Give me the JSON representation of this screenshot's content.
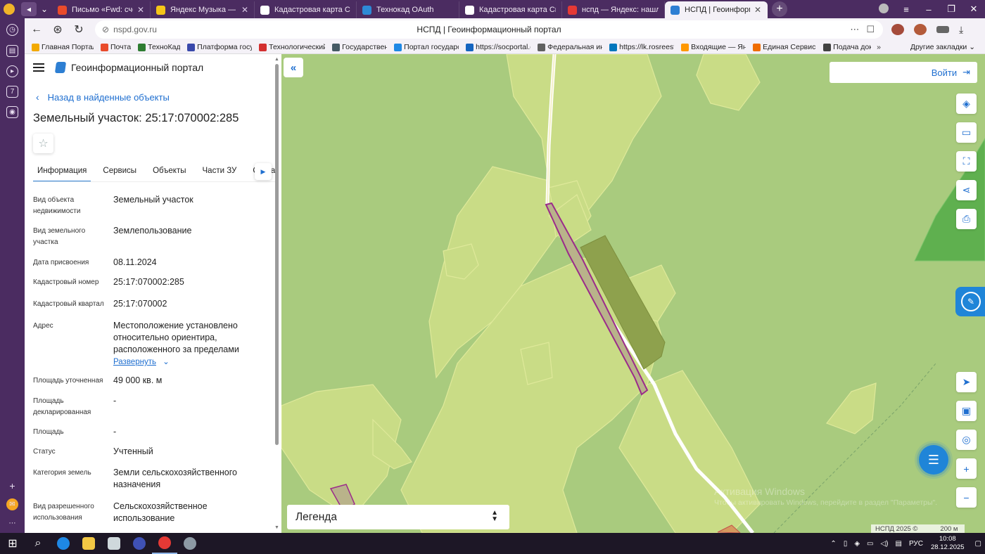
{
  "browser": {
    "tabs": [
      {
        "label": "Письмо «Fwd: счет за декабрь»",
        "icon": "mail-icon",
        "color": "#e94b2b",
        "active": false
      },
      {
        "label": "Яндекс Музыка — со",
        "icon": "music-icon",
        "color": "#f5c518",
        "active": false
      },
      {
        "label": "Кадастровая карта Сибири",
        "icon": "document-icon",
        "color": "#ffffff",
        "active": false
      },
      {
        "label": "Технокад OAuth",
        "icon": "technokad-icon",
        "color": "#2d8ad6",
        "active": false
      },
      {
        "label": "Кадастровая карта Сибири",
        "icon": "document-icon",
        "color": "#ffffff",
        "active": false
      },
      {
        "label": "нспд — Яндекс: нашлось",
        "icon": "yandex-icon",
        "color": "#e53935",
        "active": false
      },
      {
        "label": "НСПД | Геоинформационный",
        "icon": "nspd-icon",
        "color": "#2d7fd3",
        "active": true
      }
    ],
    "url": "nspd.gov.ru",
    "page_title": "НСПД | Геоинформационный портал",
    "bookmarks": [
      {
        "label": "Главная Портал Э",
        "color": "#f2a900"
      },
      {
        "label": "Почта",
        "color": "#e94b2b"
      },
      {
        "label": "ТехноКад",
        "color": "#2e7d32"
      },
      {
        "label": "Платформа госуд",
        "color": "#3949ab"
      },
      {
        "label": "Технологический",
        "color": "#d32f2f"
      },
      {
        "label": "Государственная",
        "color": "#455a64"
      },
      {
        "label": "Портал государст",
        "color": "#1e88e5"
      },
      {
        "label": "https://socportal.g",
        "color": "#1565c0"
      },
      {
        "label": "Федеральная инф",
        "color": "#616161"
      },
      {
        "label": "https://lk.rosreest",
        "color": "#0277bd"
      },
      {
        "label": "Входящие — Янде",
        "color": "#ff9800"
      },
      {
        "label": "Единая Сервисна",
        "color": "#ef6c00"
      },
      {
        "label": "Подача док",
        "color": "#424242"
      }
    ],
    "bookmarks_more": "»",
    "bookmarks_other": "Другие закладки"
  },
  "panel": {
    "portal_name": "Геоинформационный портал",
    "back_link": "Назад в найденные объекты",
    "object_title": "Земельный участок: 25:17:070002:285",
    "tabs": [
      "Информация",
      "Сервисы",
      "Объекты",
      "Части ЗУ",
      "Состав"
    ],
    "attributes": [
      {
        "label": "Вид объекта недвижимости",
        "value": "Земельный участок"
      },
      {
        "label": "Вид земельного участка",
        "value": "Землепользование"
      },
      {
        "label": "Дата присвоения",
        "value": "08.11.2024"
      },
      {
        "label": "Кадастровый номер",
        "value": "25:17:070002:285"
      },
      {
        "label": "Кадастровый квартал",
        "value": "25:17:070002"
      },
      {
        "label": "Адрес",
        "value": "Местоположение установлено относительно ориентира, расположенного за пределами"
      },
      {
        "label": "Площадь уточненная",
        "value": "49 000 кв. м"
      },
      {
        "label": "Площадь декларированная",
        "value": "-"
      },
      {
        "label": "Площадь",
        "value": "-"
      },
      {
        "label": "Статус",
        "value": "Учтенный"
      },
      {
        "label": "Категория земель",
        "value": "Земли сельскохозяйственного назначения"
      },
      {
        "label": "Вид разрешенного использования",
        "value": "Сельскохозяйственное использование"
      }
    ],
    "expand_link": "Развернуть"
  },
  "map": {
    "login_label": "Войти",
    "legend_label": "Легенда",
    "watermark_title": "Активация Windows",
    "watermark_sub": "Чтобы активировать Windows, перейдите в раздел \"Параметры\".",
    "copyright": "НСПД 2025 ©",
    "scale_label": "200 м",
    "colors": {
      "background": "#a9cb7e",
      "parcel_fill": "#cfe08a",
      "parcel_stroke": "#e2ec9a",
      "selected_stroke": "#9b2b8a",
      "dark_parcel": "#8ea14d",
      "forest": "#5fb04f"
    }
  },
  "taskbar": {
    "time": "10:08",
    "date": "28.12.2025",
    "lang": "РУС"
  }
}
